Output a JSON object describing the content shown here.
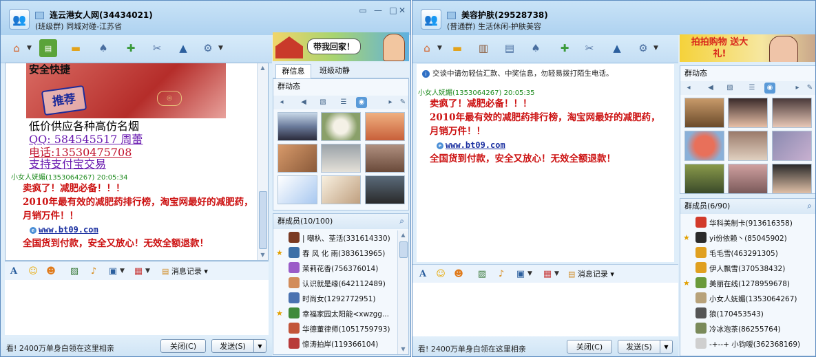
{
  "window1": {
    "title": "连云港女人网(34434021)",
    "subtitle": "(班级群) 同城对碰-江苏省",
    "banner_text": "带我回家！",
    "tabs": [
      "群信息",
      "班级动静"
    ],
    "dynamics_label": "群动态",
    "members_label": "群成员(10/100)",
    "promo": {
      "top_text": "安全快捷",
      "stamp_text": "推荐",
      "line1": "低价供应各种高仿名烟",
      "line2": "QQ: 584545517 周蕾",
      "line3": "电话:13530475708",
      "line4": "支持支付宝交易"
    },
    "message": {
      "sender": "小女人妩媚(1353064267)   20:05:34",
      "line1": "卖疯了！减肥必备！！！",
      "line2": "2010年最有效的减肥药排行榜，淘宝网最好的减肥药，月销万件！！",
      "url": "www.bt09.com",
      "line3": "全国货到付款，安全又放心！无效全额退款！"
    },
    "input_toolbar": {
      "history_label": "消息记录"
    },
    "bottom_ad": "看! 2400万单身白领在这里相亲",
    "close_label": "关闭(C)",
    "send_label": "发送(S)",
    "members": [
      {
        "name": "| 嘲杁、荃活(331614330)",
        "star": false,
        "color": "#7a3a22"
      },
      {
        "name": "春 风 化 雨(383613965)",
        "star": true,
        "color": "#3b6fa8"
      },
      {
        "name": "茉莉花香(756376014)",
        "star": false,
        "color": "#9a5cc8"
      },
      {
        "name": "认识就是缘(642112489)",
        "star": false,
        "color": "#d28c5a"
      },
      {
        "name": "时尚女(1292772951)",
        "star": false,
        "color": "#4a72b0"
      },
      {
        "name": "幸福家园太阳能<xwzgg...",
        "star": true,
        "color": "#3f8a3a"
      },
      {
        "name": "华德董律师(1051759793)",
        "star": false,
        "color": "#c2553a"
      },
      {
        "name": "惊涛拍岸(119366104)",
        "star": false,
        "color": "#b83a3a"
      }
    ]
  },
  "window2": {
    "title": "美容护肤(29528738)",
    "subtitle": "(普通群) 生活休闲-护肤美容",
    "banner_text": "拍拍购物 送大礼!",
    "notice": "交谈中请勿轻信汇款、中奖信息，勿轻易拨打陌生电话。",
    "dynamics_label": "群动态",
    "members_label": "群成员(6/90)",
    "message": {
      "sender": "小女人妩媚(1353064267)   20:05:35",
      "line1": "卖疯了！减肥必备！！！",
      "line2": "2010年最有效的减肥药排行榜，淘宝网最好的减肥药，月销万件！！",
      "url": "www.bt09.com",
      "line3": "全国货到付款，安全又放心！无效全额退款！"
    },
    "input_toolbar": {
      "history_label": "消息记录"
    },
    "bottom_ad": "看! 2400万单身白领在这里相亲",
    "close_label": "关闭(C)",
    "send_label": "发送(S)",
    "members": [
      {
        "name": "华科美制卡(913616358)",
        "star": false,
        "color": "#d23a2a"
      },
      {
        "name": "yi份依赖丶(85045902)",
        "star": true,
        "color": "#2a2a2a"
      },
      {
        "name": "毛毛雪(463291305)",
        "star": false,
        "color": "#e0a020"
      },
      {
        "name": "伊人飘雪(370538432)",
        "star": false,
        "color": "#e0a020"
      },
      {
        "name": "美丽在线(1278959678)",
        "star": true,
        "color": "#6a9a3a"
      },
      {
        "name": "小女人妩媚(1353064267)",
        "star": false,
        "color": "#b8a27a"
      },
      {
        "name": "狼(170453543)",
        "star": false,
        "color": "#555555"
      },
      {
        "name": "冷冰泡茶(86255764)",
        "star": false,
        "color": "#7a8a5a"
      },
      {
        "name": "-+--+ 小钧嗳(362368169)",
        "star": false,
        "color": "#cfcfcf"
      }
    ]
  }
}
